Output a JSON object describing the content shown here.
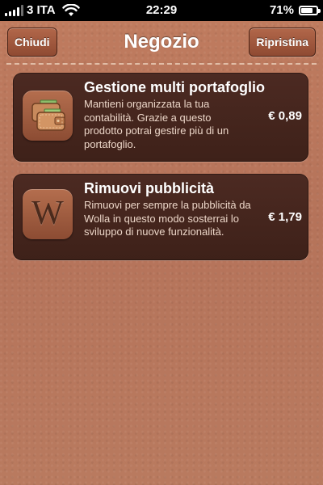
{
  "status_bar": {
    "carrier": "3 ITA",
    "time": "22:29",
    "battery_percent_label": "71%",
    "battery_level": 0.71,
    "icons": [
      "signal-icon",
      "wifi-icon",
      "battery-icon"
    ]
  },
  "nav": {
    "title": "Negozio",
    "left_button": "Chiudi",
    "right_button": "Ripristina"
  },
  "products": [
    {
      "icon": "wallets-icon",
      "title": "Gestione multi portafoglio",
      "description": "Mantieni organizzata la tua contabilità. Grazie a questo prodotto potrai gestire più di un portafoglio.",
      "price": "€ 0,89"
    },
    {
      "icon": "wolla-logo-icon",
      "title": "Rimuovi pubblicità",
      "description": "Rimuovi per sempre la pubblicità da Wolla in questo modo sosterrai lo sviluppo di nuove funzionalità.",
      "price": "€ 1,79"
    }
  ],
  "colors": {
    "background": "#b9775a",
    "card": "#452519",
    "button": "#9a5339",
    "text": "#ffffff"
  }
}
